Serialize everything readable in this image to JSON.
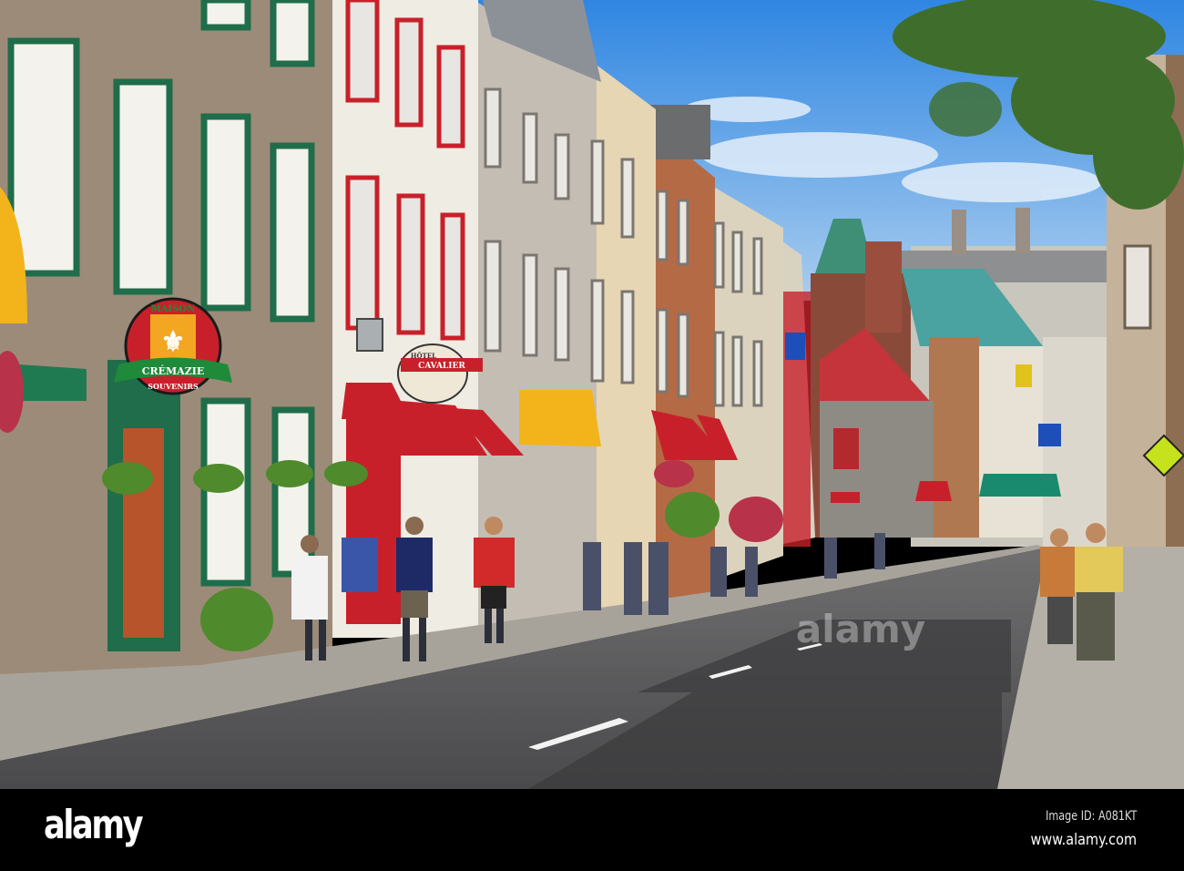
{
  "photo": {
    "signs": {
      "maison": "MAISON",
      "cremazie": "CRÉMAZIE",
      "souvenirs": "SOUVENIRS",
      "hotel": "HÔTEL",
      "cavalier": "CAVALIER"
    },
    "watermark": "alamy"
  },
  "footer": {
    "logo": "alamy",
    "image_id": "Image ID: A081KT",
    "url": "www.alamy.com"
  },
  "colors": {
    "sky": "#3f8fe0",
    "trim_green": "#1f6d4a",
    "awning_red": "#c8202a"
  }
}
